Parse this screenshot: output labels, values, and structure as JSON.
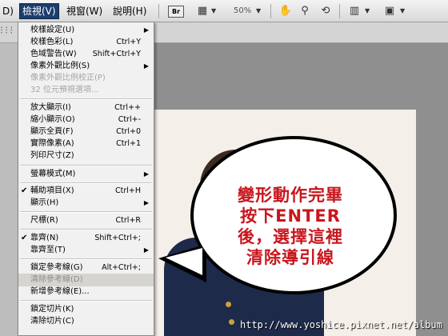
{
  "menubar": {
    "items": [
      {
        "label": "D)"
      },
      {
        "label": "檢視(V)"
      },
      {
        "label": "視窗(W)"
      },
      {
        "label": "說明(H)"
      }
    ],
    "br_label": "Br",
    "zoom": "50%"
  },
  "dropdown": {
    "items": [
      {
        "label": "校樣設定(U)",
        "shortcut": "",
        "submenu": true,
        "checked": false,
        "disabled": false
      },
      {
        "label": "校樣色彩(L)",
        "shortcut": "Ctrl+Y",
        "submenu": false,
        "checked": false,
        "disabled": false
      },
      {
        "label": "色域警告(W)",
        "shortcut": "Shift+Ctrl+Y",
        "submenu": false,
        "checked": false,
        "disabled": false
      },
      {
        "label": "像素外觀比例(S)",
        "shortcut": "",
        "submenu": true,
        "checked": false,
        "disabled": false
      },
      {
        "label": "像素外觀比例校正(P)",
        "shortcut": "",
        "submenu": false,
        "checked": false,
        "disabled": true
      },
      {
        "label": "32 位元預視選項...",
        "shortcut": "",
        "submenu": false,
        "checked": false,
        "disabled": true
      },
      {
        "label": "放大顯示(I)",
        "shortcut": "Ctrl++",
        "submenu": false,
        "checked": false,
        "disabled": false
      },
      {
        "label": "縮小顯示(O)",
        "shortcut": "Ctrl+-",
        "submenu": false,
        "checked": false,
        "disabled": false
      },
      {
        "label": "顯示全頁(F)",
        "shortcut": "Ctrl+0",
        "submenu": false,
        "checked": false,
        "disabled": false
      },
      {
        "label": "實際像素(A)",
        "shortcut": "Ctrl+1",
        "submenu": false,
        "checked": false,
        "disabled": false
      },
      {
        "label": "列印尺寸(Z)",
        "shortcut": "",
        "submenu": false,
        "checked": false,
        "disabled": false
      },
      {
        "label": "螢幕模式(M)",
        "shortcut": "",
        "submenu": true,
        "checked": false,
        "disabled": false
      },
      {
        "label": "輔助項目(X)",
        "shortcut": "Ctrl+H",
        "submenu": false,
        "checked": true,
        "disabled": false
      },
      {
        "label": "顯示(H)",
        "shortcut": "",
        "submenu": true,
        "checked": false,
        "disabled": false
      },
      {
        "label": "尺標(R)",
        "shortcut": "Ctrl+R",
        "submenu": false,
        "checked": false,
        "disabled": false
      },
      {
        "label": "靠齊(N)",
        "shortcut": "Shift+Ctrl+;",
        "submenu": false,
        "checked": true,
        "disabled": false
      },
      {
        "label": "靠齊至(T)",
        "shortcut": "",
        "submenu": true,
        "checked": false,
        "disabled": false
      },
      {
        "label": "鎖定參考線(G)",
        "shortcut": "Alt+Ctrl+;",
        "submenu": false,
        "checked": false,
        "disabled": false
      },
      {
        "label": "清除參考線(D)",
        "shortcut": "",
        "submenu": false,
        "checked": false,
        "disabled": false,
        "highlighted": true
      },
      {
        "label": "新增參考線(E)...",
        "shortcut": "",
        "submenu": false,
        "checked": false,
        "disabled": false
      },
      {
        "label": "鎖定切片(K)",
        "shortcut": "",
        "submenu": false,
        "checked": false,
        "disabled": false
      },
      {
        "label": "清除切片(C)",
        "shortcut": "",
        "submenu": false,
        "checked": false,
        "disabled": false
      }
    ]
  },
  "bubble": {
    "line1": "變形動作完畢",
    "line2": "按下ENTER",
    "line3": "後，選擇這裡",
    "line4": "清除導引線",
    "color": "#c8161d"
  },
  "watermark": "http://www.yoshice.pixnet.net/album"
}
